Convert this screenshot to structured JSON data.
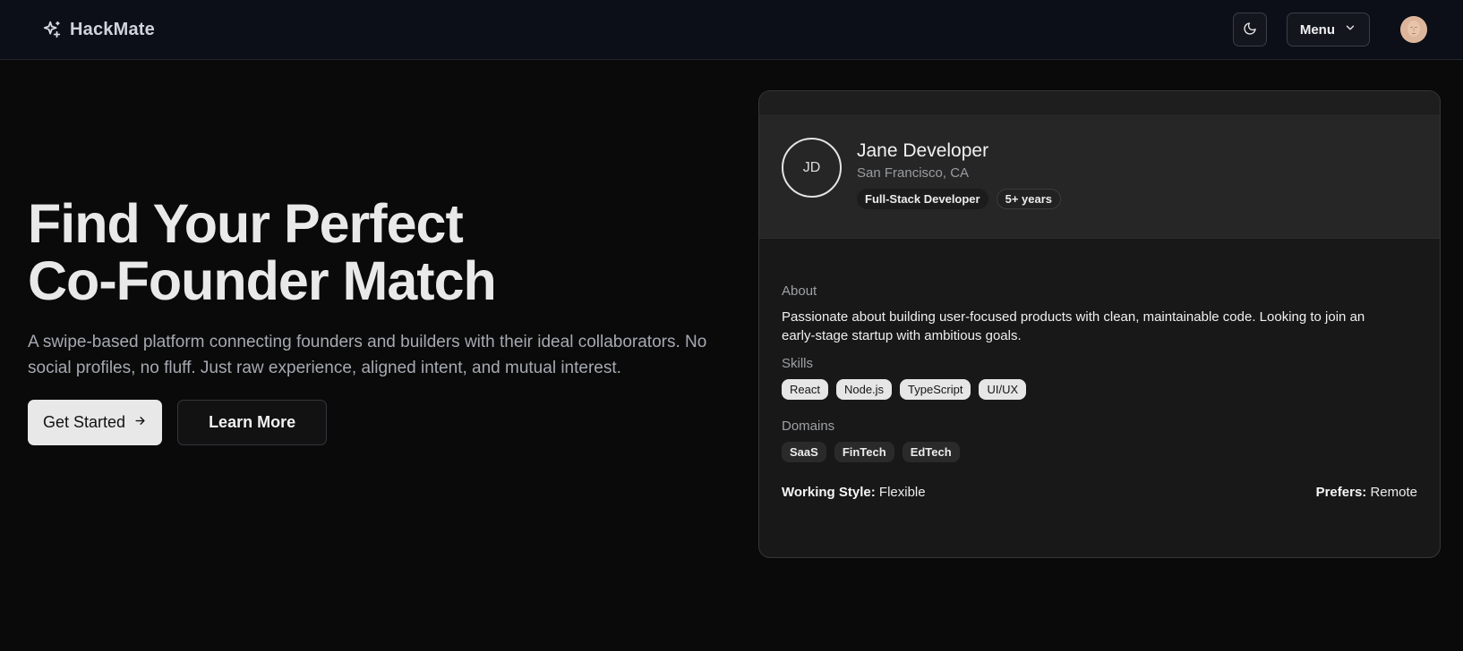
{
  "header": {
    "brand": "HackMate",
    "menu_label": "Menu"
  },
  "hero": {
    "title_line1": "Find Your Perfect",
    "title_line2": "Co-Founder Match",
    "subtitle": "A swipe-based platform connecting founders and builders with their ideal collaborators. No social profiles, no fluff. Just raw experience, aligned intent, and mutual interest.",
    "primary_button": "Get Started",
    "secondary_button": "Learn More"
  },
  "profile": {
    "initials": "JD",
    "name": "Jane Developer",
    "location": "San Francisco, CA",
    "tags": [
      "Full-Stack Developer",
      "5+ years"
    ],
    "about_label": "About",
    "about": "Passionate about building user-focused products with clean, maintainable code. Looking to join an early-stage startup with ambitious goals.",
    "skills_label": "Skills",
    "skills": [
      "React",
      "Node.js",
      "TypeScript",
      "UI/UX"
    ],
    "domains_label": "Domains",
    "domains": [
      "SaaS",
      "FinTech",
      "EdTech"
    ],
    "working_style_label": "Working Style:",
    "working_style": "Flexible",
    "prefers_label": "Prefers:",
    "prefers": "Remote"
  },
  "icons": {
    "brand": "sparkles-icon",
    "theme": "moon-icon",
    "menu": "chevron-down-icon",
    "cta": "arrow-right-icon"
  },
  "colors": {
    "background": "#0a0a0a",
    "header": "#0c0f17",
    "card": "#181818",
    "primary_button": "#e8e8e8"
  }
}
